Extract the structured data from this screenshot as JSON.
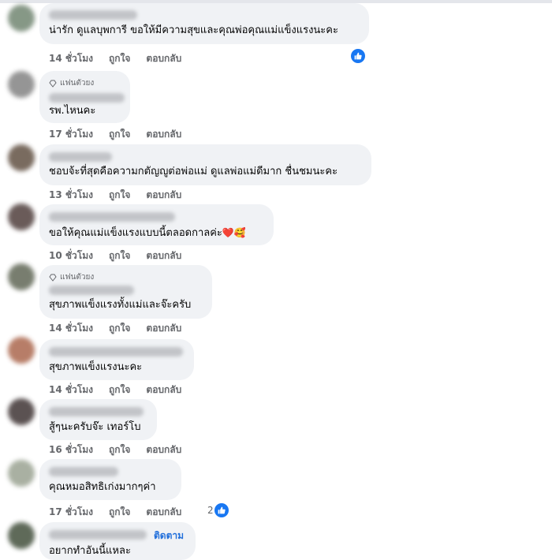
{
  "colors": {
    "bubble": "#f0f2f5",
    "meta": "#65676b",
    "accent": "#1877f2",
    "follow": "#216fdb"
  },
  "actions": {
    "like": "ถูกใจ",
    "reply": "ตอบกลับ"
  },
  "comments": [
    {
      "text": "น่ารัก ดูแลบุพการี ขอให้มีความสุขและคุณพ่อคุณแม่แข็งแรงนะคะ",
      "time": "14 ชั่วโมง",
      "liked": true
    },
    {
      "badge": "แฟนตัวยง",
      "text": "รพ.ไหนคะ",
      "time": "17 ชั่วโมง"
    },
    {
      "text": "ชอบจ้ะที่สุดคือความกตัญญูต่อพ่อแม่ ดูแลพ่อแม่ดีมาก ชื่นชมนะคะ",
      "time": "13 ชั่วโมง"
    },
    {
      "text": "ขอให้คุณแม่แข็งแรงแบบนี้ตลอดกาลค่ะ",
      "emoji": "❤️🥰",
      "time": "10 ชั่วโมง"
    },
    {
      "badge": "แฟนตัวยง",
      "text": "สุขภาพแข็งแรงทั้งแม่และจ๊ะครับ",
      "time": "14 ชั่วโมง"
    },
    {
      "text": "สุขภาพแข็งแรงนะคะ",
      "time": "14 ชั่วโมง"
    },
    {
      "text": "สู้ๆนะครับจ๊ะ เทอร์โบ",
      "time": "16 ชั่วโมง"
    },
    {
      "text": "คุณหมอสิทธิเก่งมากๆค่า",
      "time": "17 ชั่วโมง",
      "like_count": "2"
    },
    {
      "follow": "ติดตาม",
      "text": "อยากทำอันนี้แหละ"
    }
  ]
}
